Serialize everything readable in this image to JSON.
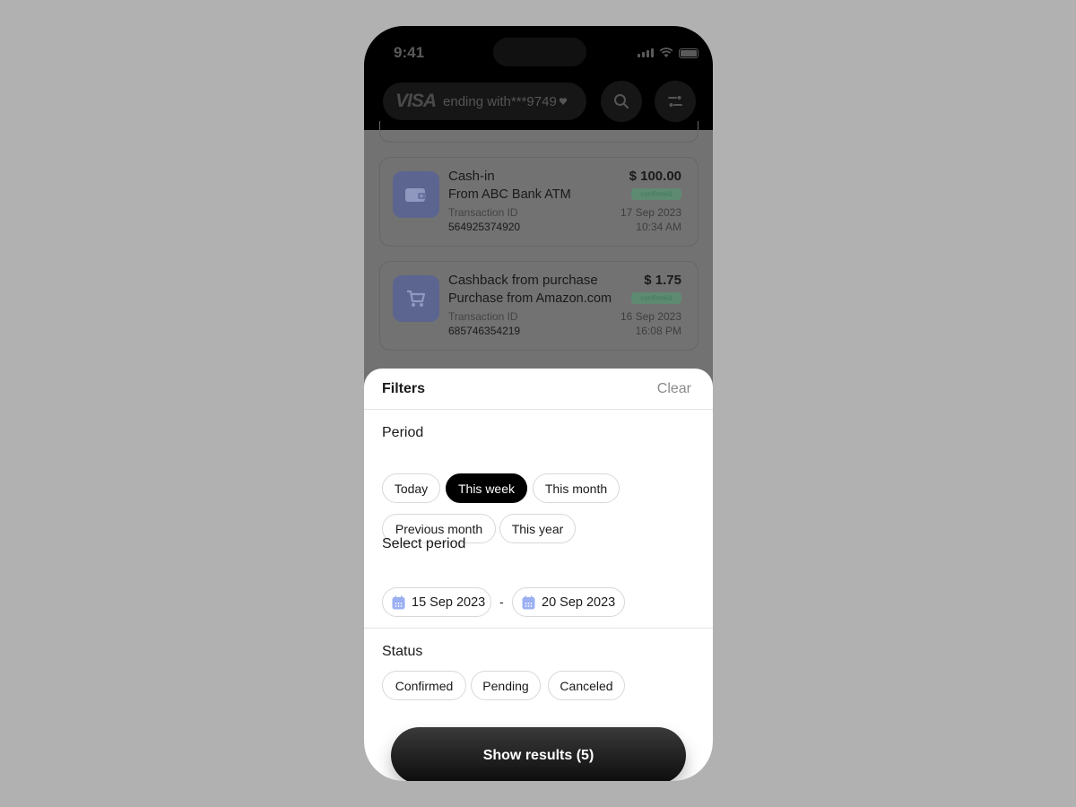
{
  "status_bar": {
    "time": "9:41"
  },
  "header": {
    "card_brand": "VISA",
    "card_label": "ending with***9749",
    "card_dropdown_icon": "heart-caret-icon",
    "search_icon": "search-icon",
    "filter_icon": "filter-icon"
  },
  "transactions": [
    {
      "title": "Cash-in",
      "subtitle": "From ABC Bank ATM",
      "id_label": "Transaction ID",
      "id": "564925374920",
      "amount": "$ 100.00",
      "status": "confirmed",
      "date": "17 Sep 2023",
      "time": "10:34 AM",
      "icon": "wallet-icon"
    },
    {
      "title": "Cashback from purchase",
      "subtitle": "Purchase from Amazon.com",
      "id_label": "Transaction ID",
      "id": "685746354219",
      "amount": "$ 1.75",
      "status": "confirmed",
      "date": "16 Sep 2023",
      "time": "16:08 PM",
      "icon": "cart-icon"
    }
  ],
  "filters": {
    "title": "Filters",
    "clear_label": "Clear",
    "period": {
      "label": "Period",
      "options": [
        "Today",
        "This week",
        "This month",
        "Previous month",
        "This year"
      ],
      "selected": "This week"
    },
    "select_period": {
      "label": "Select period",
      "from": "15 Sep 2023",
      "separator": "-",
      "to": "20 Sep 2023"
    },
    "status": {
      "label": "Status",
      "options": [
        "Confirmed",
        "Pending",
        "Canceled"
      ]
    },
    "show_results_label": "Show results (5)"
  },
  "colors": {
    "background": "#b1b1b1",
    "accent": "#000000",
    "calendar_icon": "#9bb0f2"
  }
}
